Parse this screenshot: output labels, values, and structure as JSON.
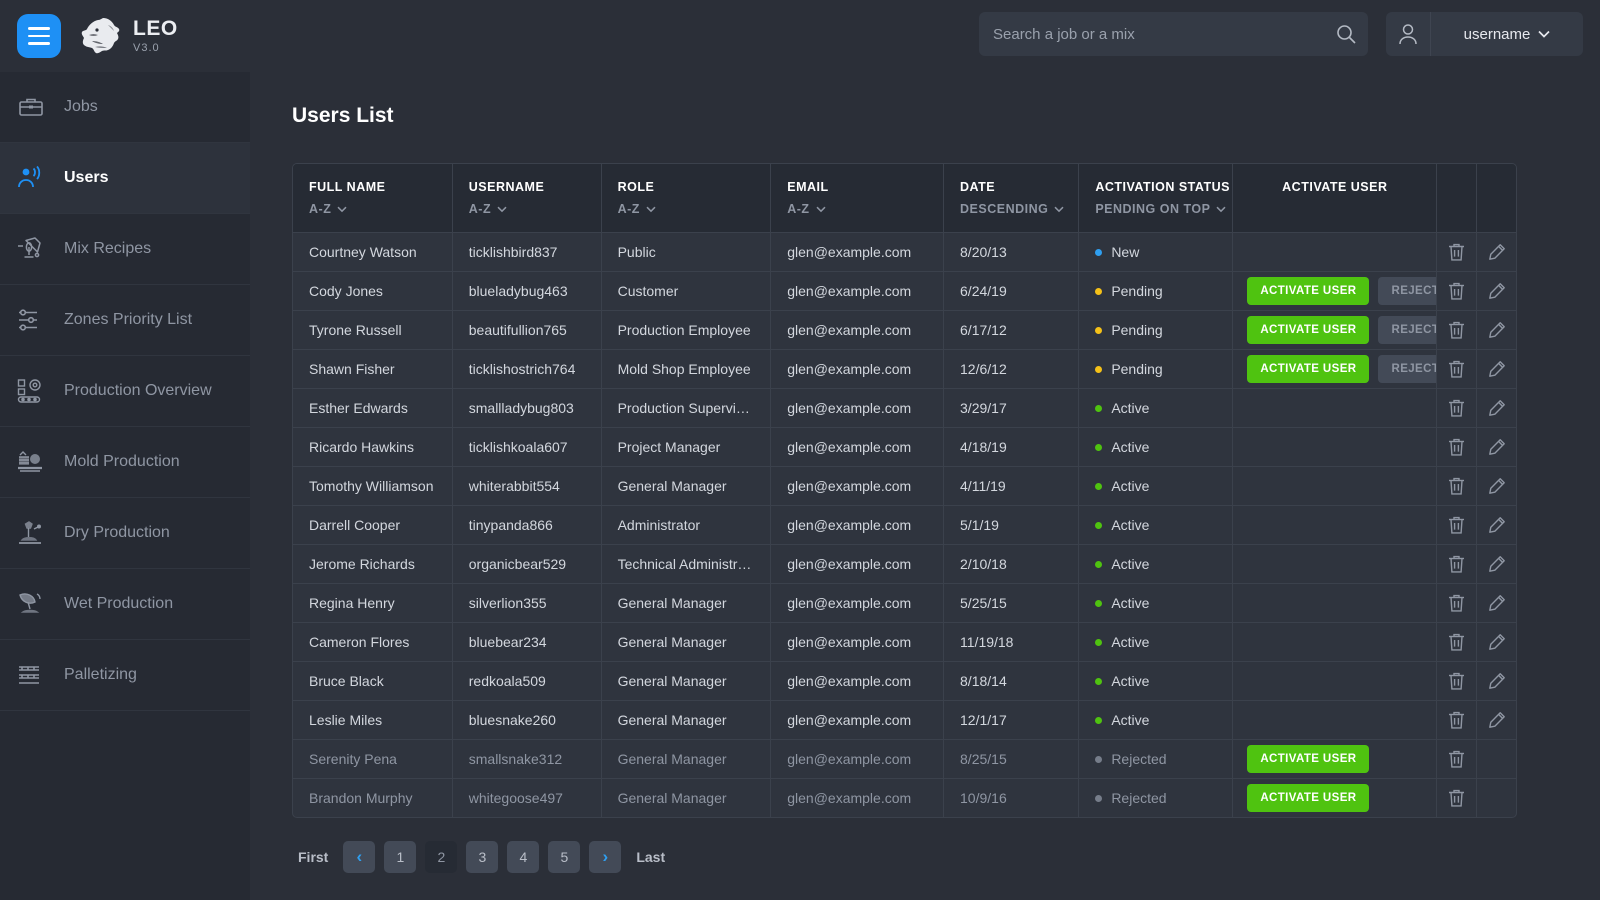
{
  "header": {
    "menu_icon": "hamburger-menu-icon",
    "logo_icon": "lion-logo-icon",
    "brand_name": "LEO",
    "brand_version": "V3.0",
    "search": {
      "placeholder": "Search a job or a mix",
      "value": "",
      "icon": "search-icon"
    },
    "account": {
      "avatar_icon": "user-avatar-icon",
      "username": "username",
      "caret": "chevron-down-icon"
    }
  },
  "sidebar": {
    "items": [
      {
        "label": "Jobs",
        "icon": "briefcase-icon",
        "active": false
      },
      {
        "label": "Users",
        "icon": "users-icon",
        "active": true
      },
      {
        "label": "Mix Recipes",
        "icon": "mixer-icon",
        "active": false
      },
      {
        "label": "Zones Priority List",
        "icon": "sliders-icon",
        "active": false
      },
      {
        "label": "Production Overview",
        "icon": "production-overview-icon",
        "active": false
      },
      {
        "label": "Mold Production",
        "icon": "mold-production-icon",
        "active": false
      },
      {
        "label": "Dry Production",
        "icon": "dry-production-icon",
        "active": false
      },
      {
        "label": "Wet Production",
        "icon": "wet-production-icon",
        "active": false
      },
      {
        "label": "Palletizing",
        "icon": "palletizing-icon",
        "active": false
      }
    ]
  },
  "main": {
    "page_title": "Users List",
    "table": {
      "columns": [
        {
          "title": "FULL NAME",
          "sort": "A-Z",
          "sortable": true,
          "align": "left"
        },
        {
          "title": "USERNAME",
          "sort": "A-Z",
          "sortable": true,
          "align": "left"
        },
        {
          "title": "ROLE",
          "sort": "A-Z",
          "sortable": true,
          "align": "left"
        },
        {
          "title": "EMAIL",
          "sort": "A-Z",
          "sortable": true,
          "align": "left"
        },
        {
          "title": "DATE",
          "sort": "DESCENDING",
          "sortable": true,
          "align": "left"
        },
        {
          "title": "ACTIVATION STATUS",
          "sort": "PENDING ON TOP",
          "sortable": true,
          "align": "left"
        },
        {
          "title": "ACTIVATE USER",
          "sort": "",
          "sortable": false,
          "align": "center"
        },
        {
          "title": "",
          "sort": "",
          "sortable": false,
          "align": "center"
        },
        {
          "title": "",
          "sort": "",
          "sortable": false,
          "align": "center"
        }
      ],
      "buttons": {
        "activate": "ACTIVATE USER",
        "reject": "REJECT REQUEST"
      },
      "icons": {
        "delete": "trash-icon",
        "edit": "pencil-icon"
      },
      "status_colors": {
        "New": "#2f9ff0",
        "Pending": "#f5c118",
        "Active": "#4fc310",
        "Rejected": "#767d8a"
      },
      "rows": [
        {
          "full_name": "Courtney Watson",
          "username": "ticklishbird837",
          "role": "Public",
          "email": "glen@example.com",
          "date": "8/20/13",
          "status": "New",
          "activate": false,
          "reject": false,
          "can_delete": true,
          "can_edit": true
        },
        {
          "full_name": "Cody Jones",
          "username": "blueladybug463",
          "role": "Customer",
          "email": "glen@example.com",
          "date": "6/24/19",
          "status": "Pending",
          "activate": true,
          "reject": true,
          "can_delete": true,
          "can_edit": true
        },
        {
          "full_name": "Tyrone Russell",
          "username": "beautifullion765",
          "role": "Production Employee",
          "email": "glen@example.com",
          "date": "6/17/12",
          "status": "Pending",
          "activate": true,
          "reject": true,
          "can_delete": true,
          "can_edit": true
        },
        {
          "full_name": "Shawn Fisher",
          "username": "ticklishostrich764",
          "role": "Mold Shop Employee",
          "email": "glen@example.com",
          "date": "12/6/12",
          "status": "Pending",
          "activate": true,
          "reject": true,
          "can_delete": true,
          "can_edit": true
        },
        {
          "full_name": "Esther Edwards",
          "username": "smallladybug803",
          "role": "Production Supervisor",
          "email": "glen@example.com",
          "date": "3/29/17",
          "status": "Active",
          "activate": false,
          "reject": false,
          "can_delete": true,
          "can_edit": true
        },
        {
          "full_name": "Ricardo Hawkins",
          "username": "ticklishkoala607",
          "role": "Project Manager",
          "email": "glen@example.com",
          "date": "4/18/19",
          "status": "Active",
          "activate": false,
          "reject": false,
          "can_delete": true,
          "can_edit": true
        },
        {
          "full_name": "Tomothy Williamson",
          "username": "whiterabbit554",
          "role": "General Manager",
          "email": "glen@example.com",
          "date": "4/11/19",
          "status": "Active",
          "activate": false,
          "reject": false,
          "can_delete": true,
          "can_edit": true
        },
        {
          "full_name": "Darrell Cooper",
          "username": "tinypanda866",
          "role": " Administrator",
          "email": "glen@example.com",
          "date": "5/1/19",
          "status": "Active",
          "activate": false,
          "reject": false,
          "can_delete": true,
          "can_edit": true
        },
        {
          "full_name": "Jerome Richards",
          "username": "organicbear529",
          "role": "Technical Administrator",
          "email": "glen@example.com",
          "date": "2/10/18",
          "status": "Active",
          "activate": false,
          "reject": false,
          "can_delete": true,
          "can_edit": true
        },
        {
          "full_name": "Regina Henry",
          "username": "silverlion355",
          "role": "General Manager",
          "email": "glen@example.com",
          "date": "5/25/15",
          "status": "Active",
          "activate": false,
          "reject": false,
          "can_delete": true,
          "can_edit": true
        },
        {
          "full_name": "Cameron Flores",
          "username": "bluebear234",
          "role": "General Manager",
          "email": "glen@example.com",
          "date": "11/19/18",
          "status": "Active",
          "activate": false,
          "reject": false,
          "can_delete": true,
          "can_edit": true
        },
        {
          "full_name": "Bruce Black",
          "username": "redkoala509",
          "role": "General Manager",
          "email": "glen@example.com",
          "date": "8/18/14",
          "status": "Active",
          "activate": false,
          "reject": false,
          "can_delete": true,
          "can_edit": true
        },
        {
          "full_name": "Leslie Miles",
          "username": "bluesnake260",
          "role": "General Manager",
          "email": "glen@example.com",
          "date": "12/1/17",
          "status": "Active",
          "activate": false,
          "reject": false,
          "can_delete": true,
          "can_edit": true
        },
        {
          "full_name": "Serenity Pena",
          "username": "smallsnake312",
          "role": "General Manager",
          "email": "glen@example.com",
          "date": "8/25/15",
          "status": "Rejected",
          "activate": true,
          "reject": false,
          "can_delete": true,
          "can_edit": false
        },
        {
          "full_name": "Brandon Murphy",
          "username": "whitegoose497",
          "role": "General Manager",
          "email": "glen@example.com",
          "date": "10/9/16",
          "status": "Rejected",
          "activate": true,
          "reject": false,
          "can_delete": true,
          "can_edit": false
        }
      ]
    },
    "pagination": {
      "first_label": "First",
      "last_label": "Last",
      "prev_icon": "chevron-left-icon",
      "next_icon": "chevron-right-icon",
      "pages": [
        "1",
        "2",
        "3",
        "4",
        "5"
      ],
      "current": "2"
    }
  },
  "colors": {
    "accent_blue": "#1e90f5",
    "green": "#4fc310",
    "yellow": "#f5c118",
    "bg": "#2b2f38",
    "sidebar_bg": "#262a33"
  }
}
